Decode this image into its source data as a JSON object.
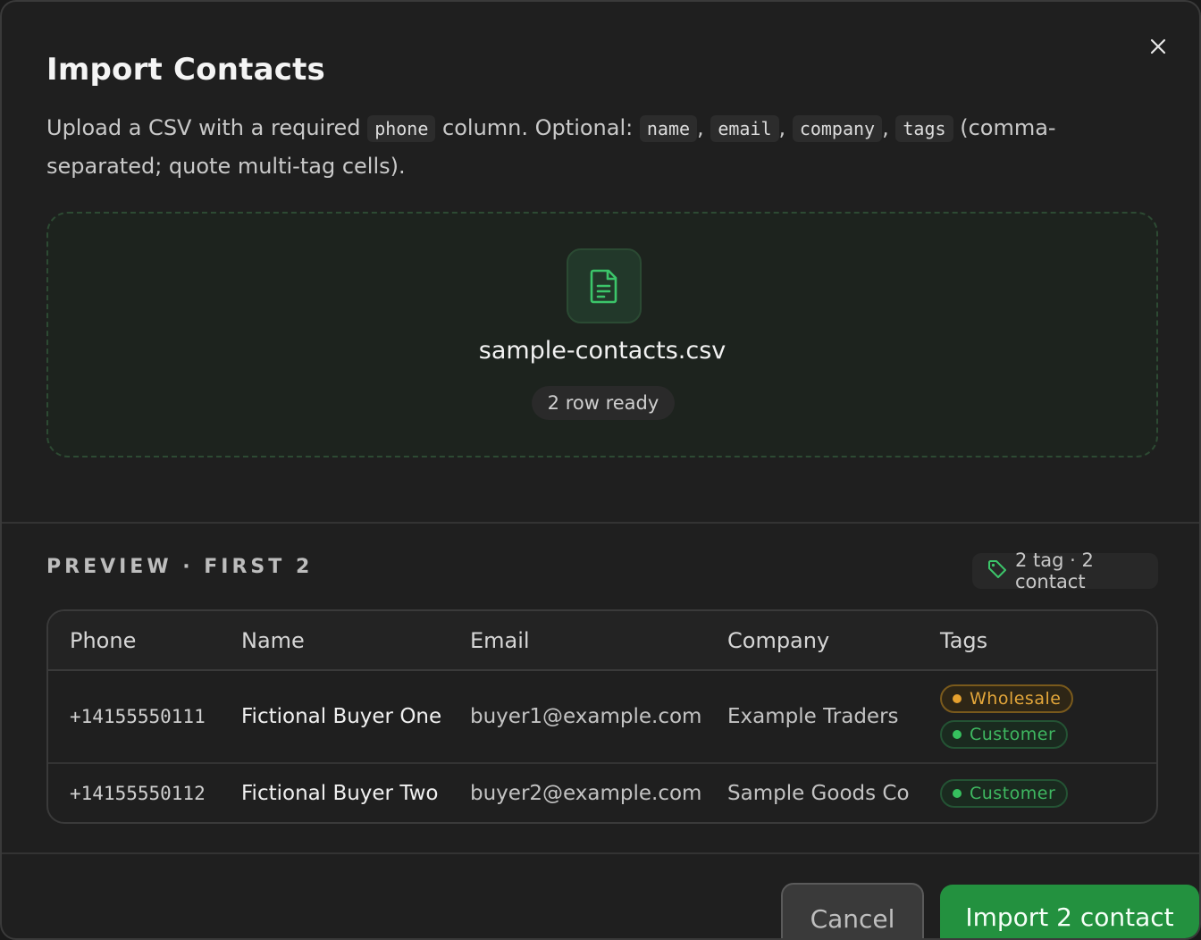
{
  "dialog": {
    "title": "Import Contacts",
    "description": {
      "part1": "Upload a CSV with a required",
      "code_phone": "phone",
      "part2": "column. Optional:",
      "code_name": "name",
      "code_email": "email",
      "code_company": "company",
      "code_tags": "tags",
      "sep": ",",
      "part3": "(comma-separated; quote multi-tag cells)."
    }
  },
  "dropzone": {
    "file_name": "sample-contacts.csv",
    "row_status": "2 row ready",
    "icon": "file-text-icon"
  },
  "preview": {
    "label": "PREVIEW · FIRST 2",
    "summary": "2 tag · 2 contact",
    "summary_icon": "tag-icon"
  },
  "table": {
    "headers": [
      "Phone",
      "Name",
      "Email",
      "Company",
      "Tags"
    ],
    "rows": [
      {
        "phone": "+14155550111",
        "name": "Fictional Buyer One",
        "email": "buyer1@example.com",
        "company": "Example Traders",
        "tags": [
          "Wholesale",
          "Customer"
        ]
      },
      {
        "phone": "+14155550112",
        "name": "Fictional Buyer Two",
        "email": "buyer2@example.com",
        "company": "Sample Goods Co",
        "tags": [
          "Customer"
        ]
      }
    ]
  },
  "footer": {
    "cancel_label": "Cancel",
    "import_label": "Import 2 contact"
  },
  "colors": {
    "accent": "#23913f",
    "wholesale": "#e3a63a",
    "customer": "#3fb861",
    "background": "#1f1f1f"
  }
}
